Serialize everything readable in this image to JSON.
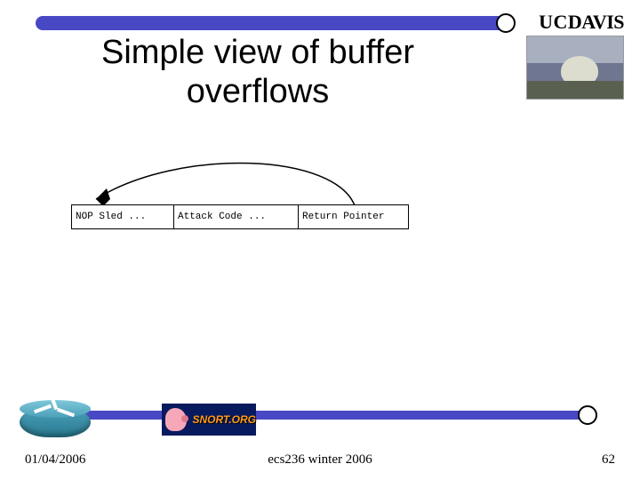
{
  "header": {
    "logo_uc": "UC",
    "logo_davis": "DAVIS"
  },
  "slide": {
    "title": "Simple view of buffer overflows"
  },
  "diagram": {
    "cell1": "NOP Sled ...",
    "cell2": "Attack Code ...",
    "cell3": "Return Pointer"
  },
  "logos": {
    "snort_text": "SNORT.ORG"
  },
  "footer": {
    "date": "01/04/2006",
    "course": "ecs236 winter 2006",
    "page": "62"
  }
}
